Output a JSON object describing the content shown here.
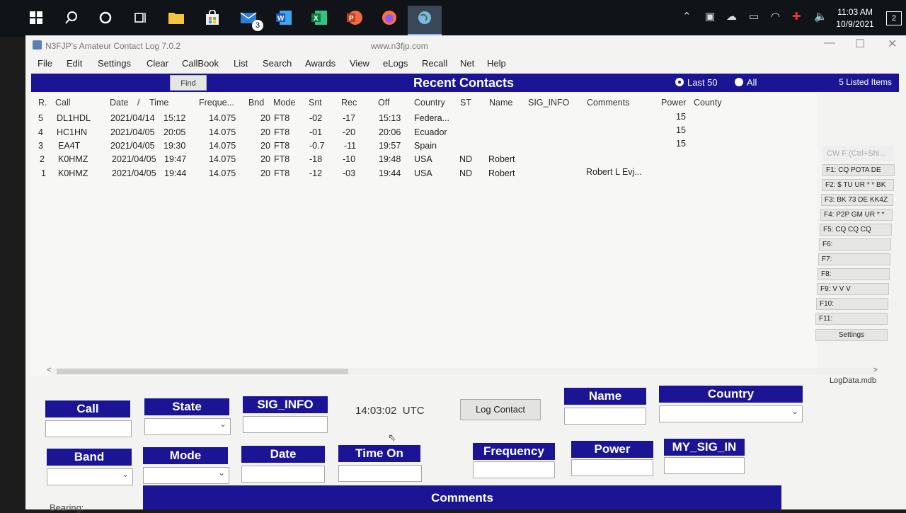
{
  "taskbar": {
    "icons": [
      "windows-start-icon",
      "search-icon",
      "cortana-icon",
      "task-view-icon",
      "file-explorer-icon",
      "store-icon",
      "mail-icon",
      "word-icon",
      "excel-icon",
      "powerpoint-icon",
      "firefox-icon",
      "globe-app-icon"
    ],
    "mail_badge": "3",
    "clock_time": "11:03 AM",
    "clock_date": "10/9/2021",
    "notification_count": "2"
  },
  "window": {
    "title": "N3FJP's Amateur Contact Log 7.0.2",
    "url": "www.n3fjp.com",
    "controls": [
      "—",
      "☐",
      "✕"
    ]
  },
  "menu": [
    "File",
    "Edit",
    "Settings",
    "Clear",
    "CallBook",
    "List",
    "Search",
    "Awards",
    "View",
    "eLogs",
    "Recall",
    "Net",
    "Help"
  ],
  "header": {
    "find_label": "Find",
    "title": "Recent Contacts",
    "radio_last50": "Last 50",
    "radio_all": "All",
    "listed_items": "5 Listed Items"
  },
  "table": {
    "columns": [
      "R.",
      "Call",
      "Date",
      "/",
      "Time",
      "Freque...",
      "Bnd",
      "Mode",
      "Snt",
      "Rec",
      "Off",
      "Country",
      "ST",
      "Name",
      "SIG_INFO",
      "Comments",
      "Power",
      "County"
    ],
    "rows": [
      {
        "r": "5",
        "call": "DL1HDL",
        "date": "2021/04/14",
        "time": "15:12",
        "freq": "14.075",
        "bnd": "20",
        "mode": "FT8",
        "snt": "-02",
        "rec": "-17",
        "off": "15:13",
        "country": "Federa...",
        "st": "",
        "name": "",
        "sig": "",
        "comments": "",
        "power": "15"
      },
      {
        "r": "4",
        "call": "HC1HN",
        "date": "2021/04/05",
        "time": "20:05",
        "freq": "14.075",
        "bnd": "20",
        "mode": "FT8",
        "snt": "-01",
        "rec": "-20",
        "off": "20:06",
        "country": "Ecuador",
        "st": "",
        "name": "",
        "sig": "",
        "comments": "",
        "power": "15"
      },
      {
        "r": "3",
        "call": "EA4T",
        "date": "2021/04/05",
        "time": "19:30",
        "freq": "14.075",
        "bnd": "20",
        "mode": "FT8",
        "snt": "-0.7",
        "rec": "-11",
        "off": "19:57",
        "country": "Spain",
        "st": "",
        "name": "",
        "sig": "",
        "comments": "",
        "power": "15"
      },
      {
        "r": "2",
        "call": "K0HMZ",
        "date": "2021/04/05",
        "time": "19:47",
        "freq": "14.075",
        "bnd": "20",
        "mode": "FT8",
        "snt": "-18",
        "rec": "-10",
        "off": "19:48",
        "country": "USA",
        "st": "ND",
        "name": "Robert",
        "sig": "",
        "comments": "",
        "power": ""
      },
      {
        "r": "1",
        "call": "K0HMZ",
        "date": "2021/04/05",
        "time": "19:44",
        "freq": "14.075",
        "bnd": "20",
        "mode": "FT8",
        "snt": "-12",
        "rec": "-03",
        "off": "19:44",
        "country": "USA",
        "st": "ND",
        "name": "Robert",
        "sig": "",
        "comments": "Robert L Evj...",
        "power": ""
      }
    ]
  },
  "logdata_file": "LogData.mdb",
  "cw_panel": {
    "title": "CW F (Ctrl+Shi...",
    "keys": [
      "F1: CQ POTA DE",
      "F2: $ TU UR  *  *  BK",
      "F3: BK  73 DE KK4Z",
      "F4: P2P GM UR * *",
      "F5: CQ CQ CQ",
      "F6:",
      "F7:",
      "F8:",
      "F9: V V V",
      "F10:",
      "F11:"
    ],
    "settings_label": "Settings"
  },
  "form": {
    "call": "Call",
    "state": "State",
    "sig_info": "SIG_INFO",
    "utc_time": "14:03:02",
    "utc_label": "UTC",
    "log_contact": "Log Contact",
    "name": "Name",
    "country": "Country",
    "band": "Band",
    "mode": "Mode",
    "date": "Date",
    "time_on": "Time On",
    "frequency": "Frequency",
    "power": "Power",
    "my_sig_info": "MY_SIG_IN",
    "bearing": "Bearing:",
    "comments": "Comments"
  }
}
